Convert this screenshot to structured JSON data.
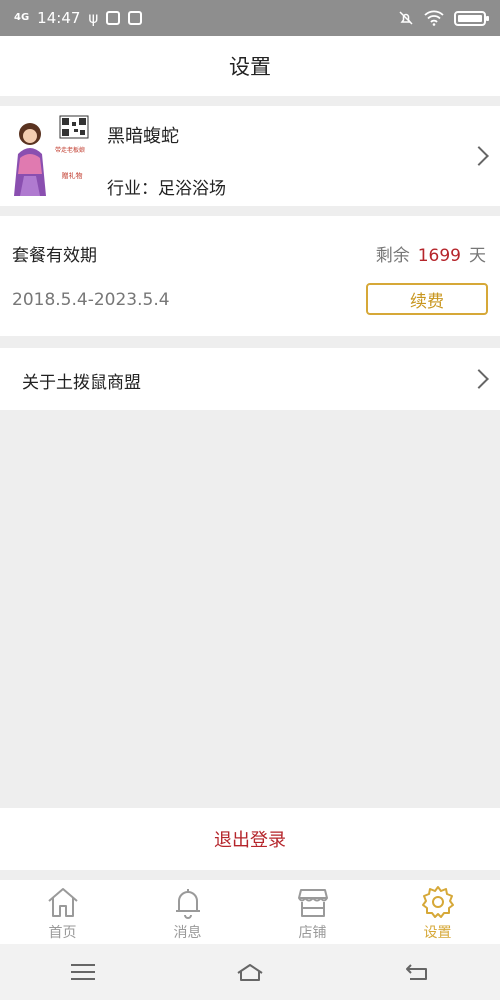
{
  "status_bar": {
    "network": "4G",
    "time": "14:47",
    "icons": [
      "signal-icon",
      "usb-icon",
      "app-notification-icon",
      "check-icon",
      "mute-icon",
      "wifi-icon",
      "battery-icon"
    ]
  },
  "header": {
    "title": "设置"
  },
  "profile": {
    "name": "黑暗蝮蛇",
    "industry": "行业：足浴浴场",
    "avatar_lines": [
      "带走老板娘",
      "赠礼物"
    ]
  },
  "plan": {
    "title": "套餐有效期",
    "remaining_prefix": "剩余",
    "remaining_days": "1699",
    "remaining_unit": "天",
    "date_range": "2018.5.4-2023.5.4",
    "renew_label": "续费"
  },
  "about": {
    "label": "关于土拨鼠商盟"
  },
  "logout": {
    "label": "退出登录"
  },
  "tabs": [
    {
      "label": "首页",
      "icon": "home-icon",
      "active": false
    },
    {
      "label": "消息",
      "icon": "bell-icon",
      "active": false
    },
    {
      "label": "店铺",
      "icon": "store-icon",
      "active": false
    },
    {
      "label": "设置",
      "icon": "gear-icon",
      "active": true
    }
  ],
  "colors": {
    "accent_gold": "#d6a838",
    "accent_red": "#b5252b",
    "status_bar_bg": "#8e8e8e",
    "page_bg": "#eeeeee"
  }
}
